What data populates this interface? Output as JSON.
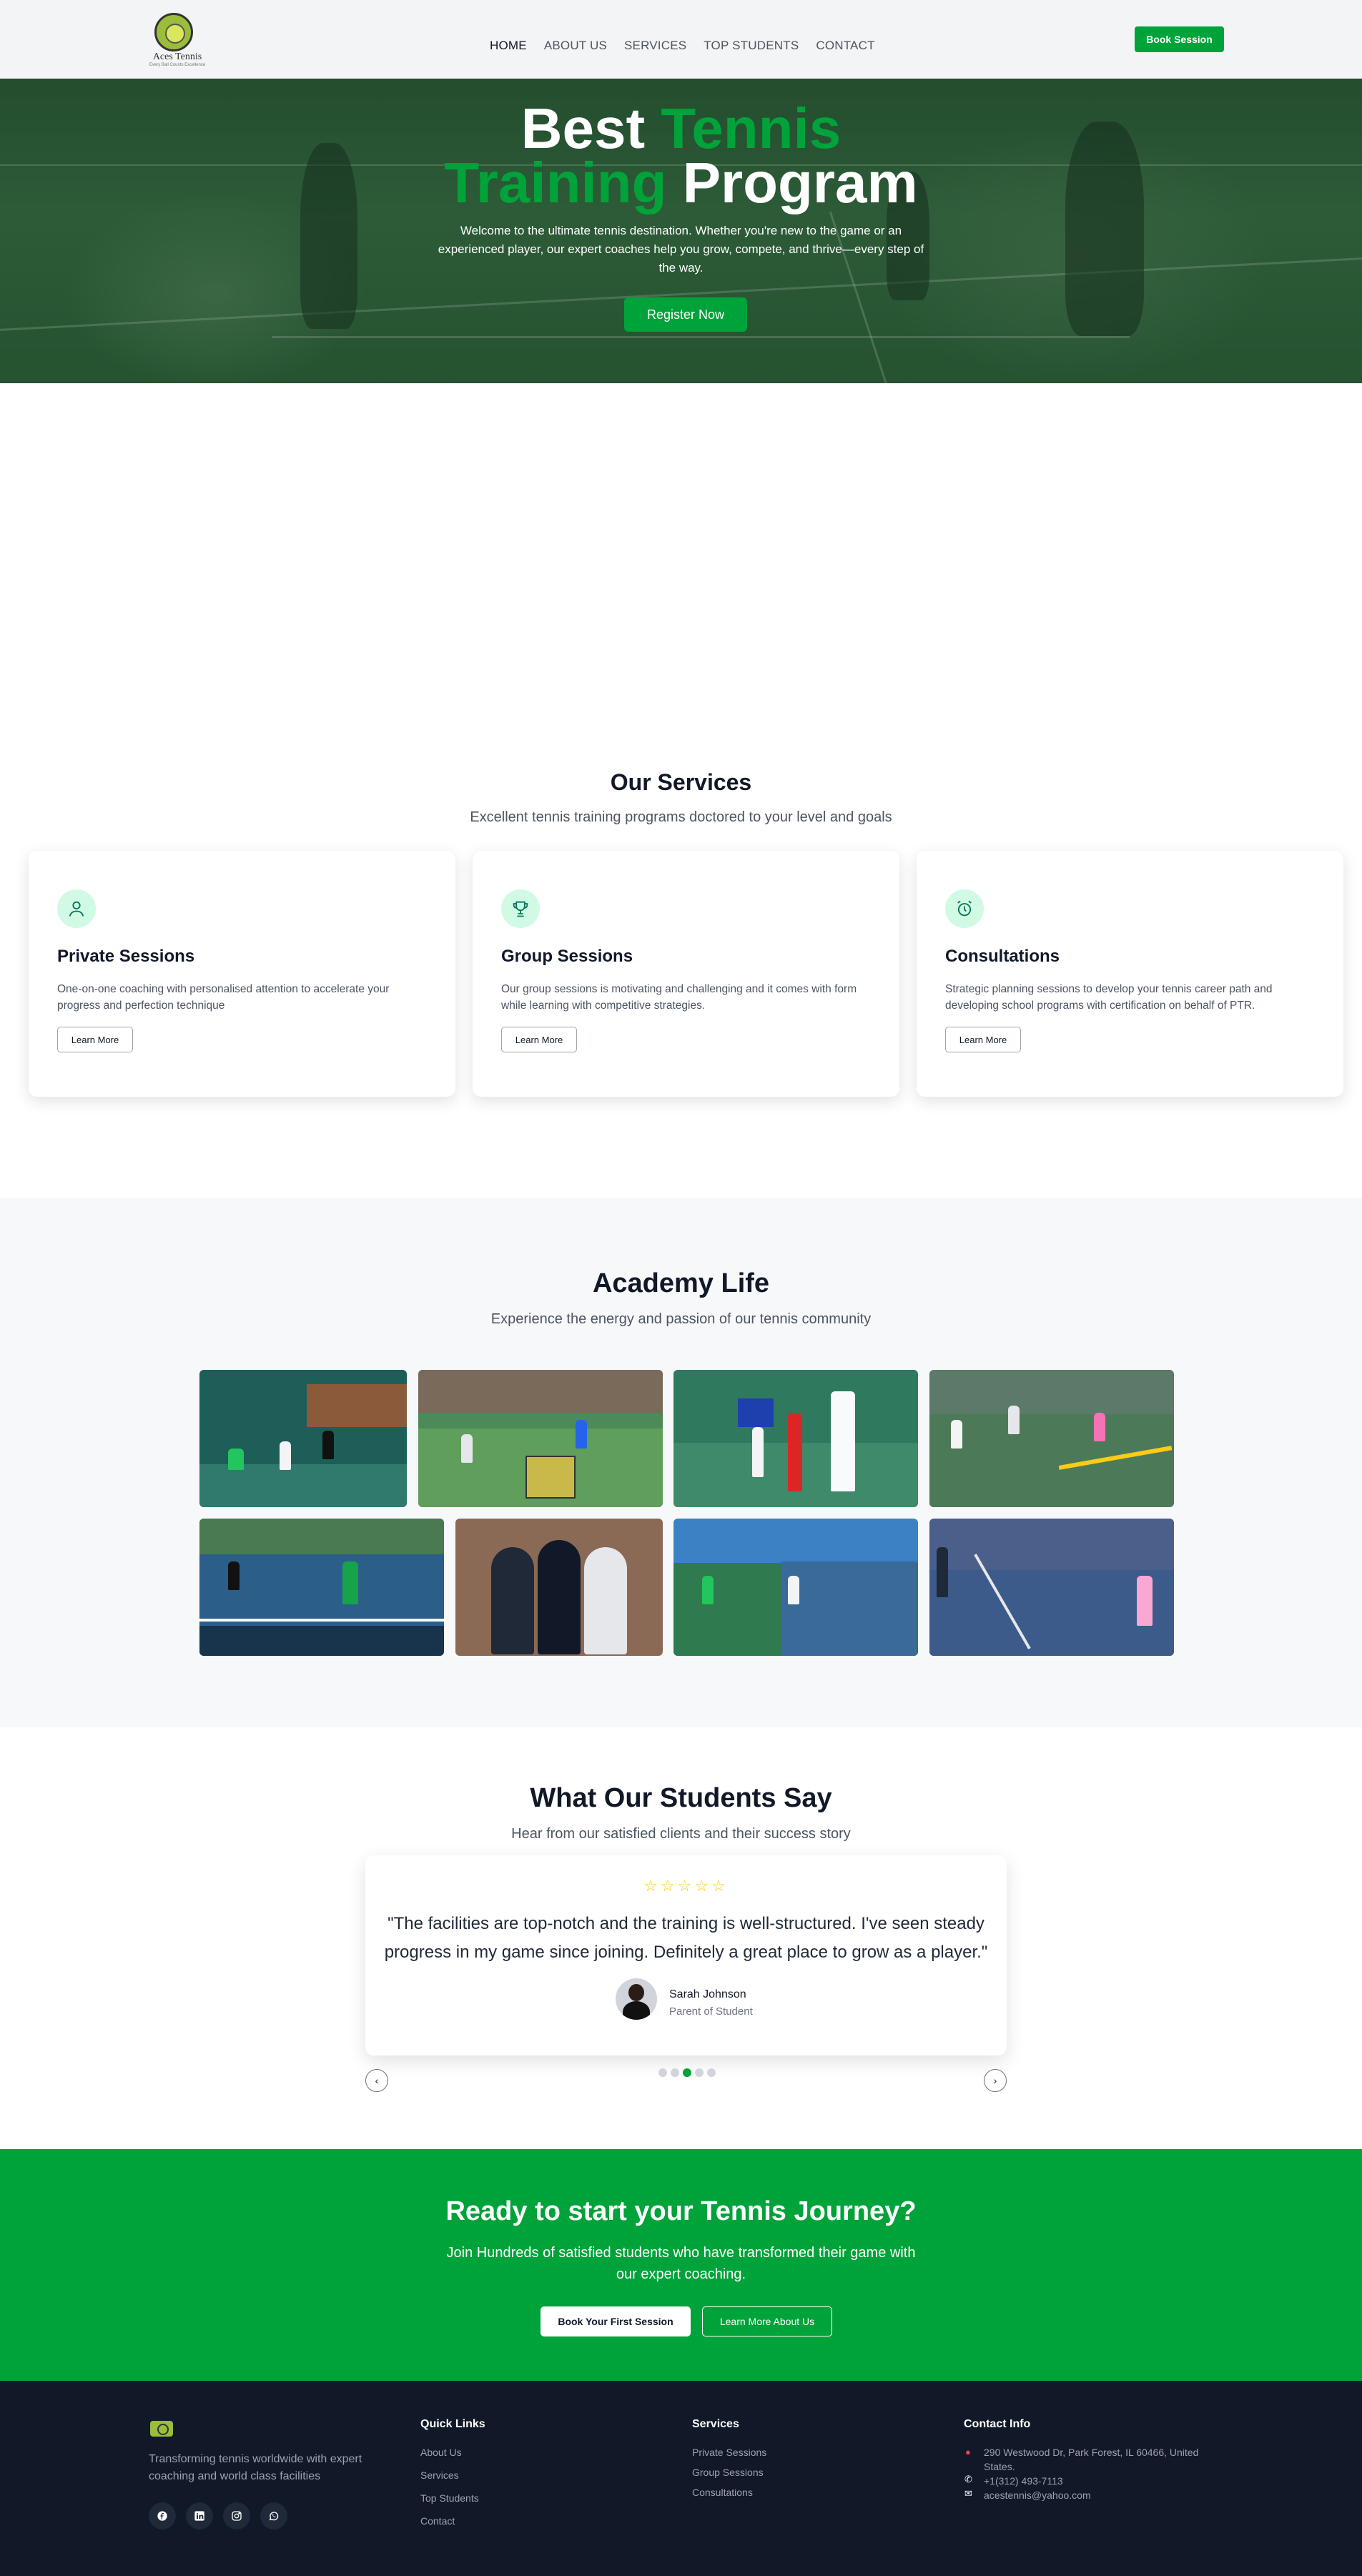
{
  "nav": {
    "logo_text": "Aces Tennis",
    "logo_sub": "Every Ball Counts Excellence",
    "items": [
      {
        "label": "HOME"
      },
      {
        "label": "ABOUT US"
      },
      {
        "label": "SERVICES"
      },
      {
        "label": "TOP STUDENTS"
      },
      {
        "label": "CONTACT"
      }
    ],
    "book_label": "Book Session"
  },
  "hero": {
    "title_word1": "Best",
    "title_word2": "Tennis",
    "title_word3": "Training",
    "title_word4": "Program",
    "text": "Welcome to the ultimate tennis destination. Whether you're new to the game or an experienced player, our expert coaches help you grow, compete, and thrive—every step of the way.",
    "button": "Register Now"
  },
  "services": {
    "title": "Our Services",
    "subtitle": "Excellent tennis training programs doctored to your level and goals",
    "cards": [
      {
        "icon": "user-icon",
        "title": "Private Sessions",
        "desc": "One-on-one coaching with personalised attention to accelerate your progress and perfection technique",
        "button": "Learn More"
      },
      {
        "icon": "trophy-icon",
        "title": "Group Sessions",
        "desc": "Our group sessions is motivating and challenging and it comes with form while learning with competitive strategies.",
        "button": "Learn More"
      },
      {
        "icon": "alarm-clock-icon",
        "title": "Consultations",
        "desc": "Strategic planning sessions to develop your tennis career path and developing school programs with certification on behalf of PTR.",
        "button": "Learn More"
      }
    ]
  },
  "academy": {
    "title": "Academy Life",
    "subtitle": "Experience the energy and passion of our tennis community"
  },
  "testimonials": {
    "title": "What Our Students Say",
    "subtitle": "Hear from our satisfied clients and their success story",
    "stars": "☆☆☆☆☆",
    "quote": "\"The facilities are top-notch and the training is well-structured. I've seen steady progress in my game since joining. Definitely a great place to grow as a player.\"",
    "name": "Sarah Johnson",
    "role": "Parent of Student",
    "prev": "‹",
    "next": "›"
  },
  "cta": {
    "title": "Ready to start your Tennis Journey?",
    "text": "Join Hundreds of satisfied students who have transformed their game with our expert coaching.",
    "primary": "Book Your First Session",
    "secondary": "Learn More About Us"
  },
  "footer": {
    "desc": "Transforming tennis worldwide with expert coaching and world class facilities",
    "quick_links_title": "Quick Links",
    "quick_links": [
      {
        "label": "About Us"
      },
      {
        "label": "Services"
      },
      {
        "label": "Top Students"
      },
      {
        "label": "Contact"
      }
    ],
    "services_title": "Services",
    "services": [
      {
        "label": "Private Sessions"
      },
      {
        "label": "Group Sessions"
      },
      {
        "label": "Consultations"
      }
    ],
    "contact_title": "Contact Info",
    "address": "290 Westwood Dr, Park Forest, IL 60466, United States.",
    "phone": "+1(312) 493-7113",
    "email": "acestennis@yahoo.com"
  },
  "colors": {
    "brand_green": "#00a33a",
    "footer_bg": "#111827",
    "icon_bg": "#d1fae5",
    "star": "#facc15"
  }
}
